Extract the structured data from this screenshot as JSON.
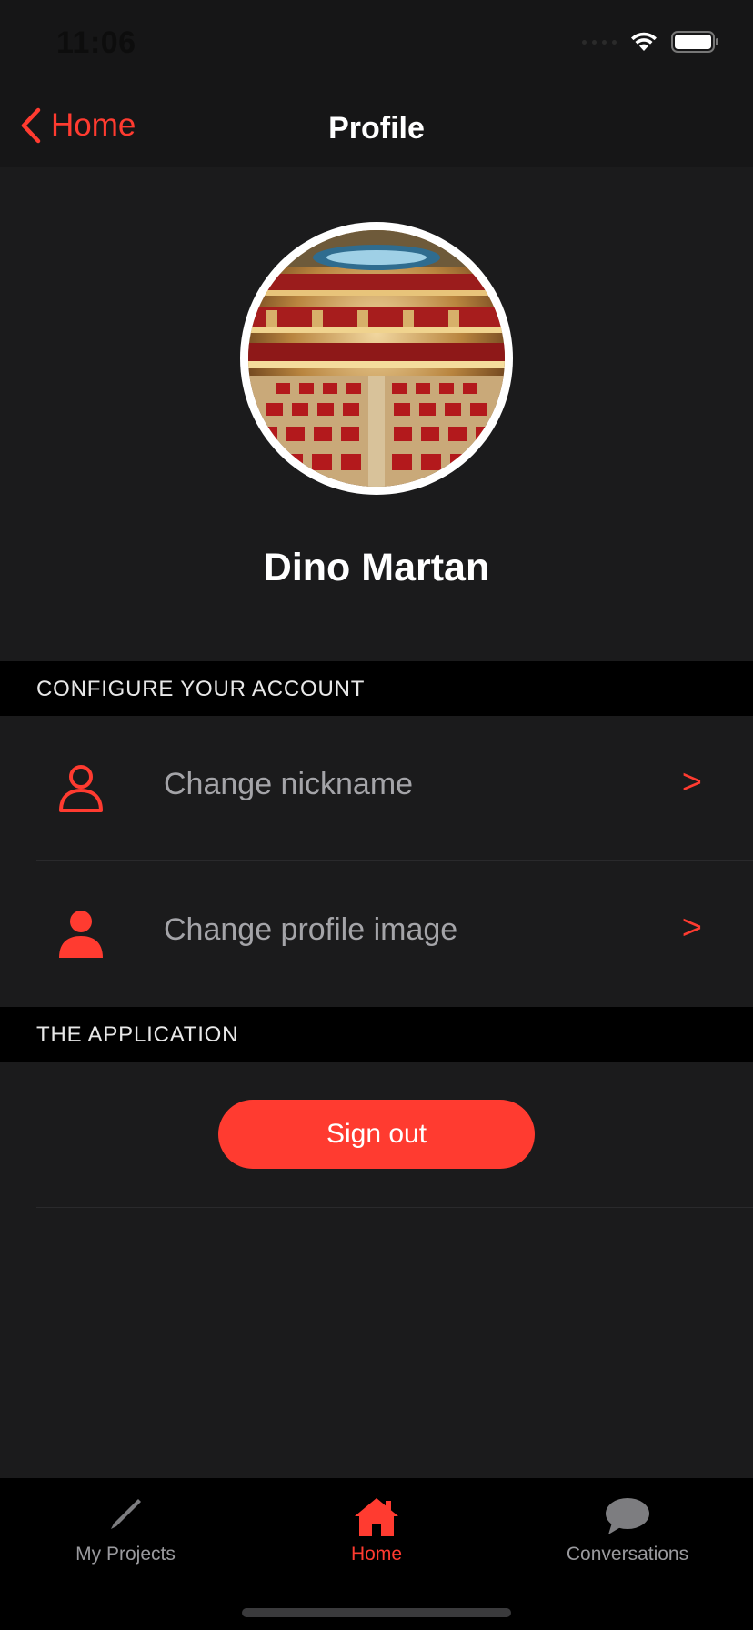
{
  "status_bar": {
    "time": "11:06"
  },
  "nav": {
    "back_label": "Home",
    "title": "Profile"
  },
  "profile": {
    "name": "Dino Martan",
    "avatar_description": "theater-interior-photo"
  },
  "sections": {
    "configure_header": "CONFIGURE YOUR ACCOUNT",
    "application_header": "THE APPLICATION"
  },
  "rows": [
    {
      "label": "Change nickname",
      "icon": "person-outline-icon",
      "chevron": ">"
    },
    {
      "label": "Change profile image",
      "icon": "person-filled-icon",
      "chevron": ">"
    }
  ],
  "actions": {
    "sign_out_label": "Sign out"
  },
  "tabs": [
    {
      "label": "My Projects",
      "icon": "pencil-icon",
      "active": false
    },
    {
      "label": "Home",
      "icon": "house-icon",
      "active": true
    },
    {
      "label": "Conversations",
      "icon": "speech-bubble-icon",
      "active": false
    }
  ],
  "colors": {
    "accent": "#ff3b30",
    "background": "#1b1b1c",
    "section_header": "#000000",
    "row_text": "#a4a4a8"
  }
}
